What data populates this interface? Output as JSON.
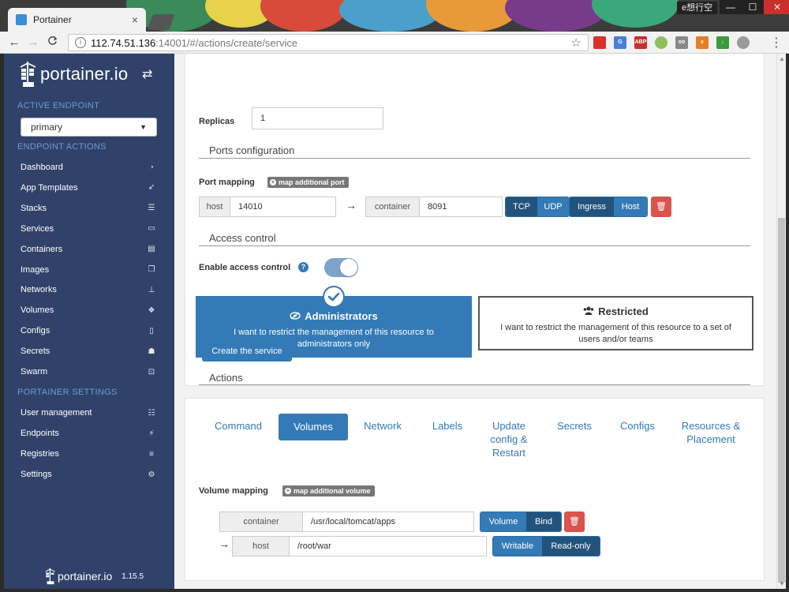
{
  "browser": {
    "tab_title": "Portainer",
    "tab_close": "×",
    "window_user": "e想行空",
    "win_min": "—",
    "win_max": "☐",
    "win_close": "✕",
    "back": "←",
    "forward": "→",
    "reload": "C",
    "url_host": "112.74.51.136",
    "url_rest": ":14001/#/actions/create/service",
    "star": "☆",
    "extensions": [
      {
        "name": "ext-red-icon",
        "label": "",
        "color": "#d9302c"
      },
      {
        "name": "ext-translate-icon",
        "label": "G",
        "color": "#4a7fd6"
      },
      {
        "name": "ext-abp-icon",
        "label": "ABP",
        "color": "#c9302c"
      },
      {
        "name": "ext-circle-icon",
        "label": "",
        "color": "#8fbf5c"
      },
      {
        "name": "ext-glasses-icon",
        "label": "oo",
        "color": "#888888"
      },
      {
        "name": "ext-orange-icon",
        "label": "x",
        "color": "#e67e22"
      },
      {
        "name": "ext-green-icon",
        "label": "↓",
        "color": "#3c9a3c"
      },
      {
        "name": "ext-gray-icon",
        "label": "",
        "color": "#9a9a9a"
      }
    ],
    "menu_dots": "⋮"
  },
  "sidebar": {
    "logo_text": "portainer.io",
    "active_endpoint_heading": "ACTIVE ENDPOINT",
    "endpoint_selected": "primary",
    "endpoint_actions_heading": "ENDPOINT ACTIONS",
    "endpoint_items": [
      {
        "label": "Dashboard",
        "icon": "speedometer"
      },
      {
        "label": "App Templates",
        "icon": "rocket"
      },
      {
        "label": "Stacks",
        "icon": "list"
      },
      {
        "label": "Services",
        "icon": "services"
      },
      {
        "label": "Containers",
        "icon": "server"
      },
      {
        "label": "Images",
        "icon": "clone"
      },
      {
        "label": "Networks",
        "icon": "sitemap"
      },
      {
        "label": "Volumes",
        "icon": "cubes"
      },
      {
        "label": "Configs",
        "icon": "file-code"
      },
      {
        "label": "Secrets",
        "icon": "user-secret"
      },
      {
        "label": "Swarm",
        "icon": "object-group"
      }
    ],
    "settings_heading": "PORTAINER SETTINGS",
    "settings_items": [
      {
        "label": "User management",
        "icon": "users"
      },
      {
        "label": "Endpoints",
        "icon": "plug"
      },
      {
        "label": "Registries",
        "icon": "database"
      },
      {
        "label": "Settings",
        "icon": "cogs"
      }
    ],
    "footer_text": "portainer.io",
    "footer_version": "1.15.5"
  },
  "form": {
    "replicas_label": "Replicas",
    "replicas_value": "1",
    "ports_title": "Ports configuration",
    "port_mapping_label": "Port mapping",
    "map_port_button": "map additional port",
    "host_addon": "host",
    "host_port": "14010",
    "container_addon": "container",
    "container_port": "8091",
    "arrow": "→",
    "protocol_tcp": "TCP",
    "protocol_udp": "UDP",
    "mode_ingress": "Ingress",
    "mode_host": "Host",
    "access_title": "Access control",
    "enable_access_label": "Enable access control",
    "help": "?",
    "admin_title": "Administrators",
    "admin_desc": "I want to restrict the management of this resource to administrators only",
    "restricted_title": "Restricted",
    "restricted_desc": "I want to restrict the management of this resource to a set of users and/or teams",
    "actions_title": "Actions",
    "create_button": "Create the service"
  },
  "tabs": [
    {
      "label": "Command"
    },
    {
      "label": "Volumes",
      "active": true
    },
    {
      "label": "Network"
    },
    {
      "label": "Labels"
    },
    {
      "label": "Update config & Restart"
    },
    {
      "label": "Secrets"
    },
    {
      "label": "Configs"
    },
    {
      "label": "Resources & Placement"
    }
  ],
  "volumes": {
    "mapping_label": "Volume mapping",
    "map_volume_button": "map additional volume",
    "container_addon": "container",
    "container_path": "/usr/local/tomcat/apps",
    "type_volume": "Volume",
    "type_bind": "Bind",
    "host_addon": "host",
    "host_path": "/root/war",
    "writable": "Writable",
    "read_only": "Read-only"
  },
  "colors": {
    "sidebar_bg": "#30426a",
    "primary": "#337ab7",
    "primary_dark": "#23527c",
    "danger": "#d9534f"
  }
}
